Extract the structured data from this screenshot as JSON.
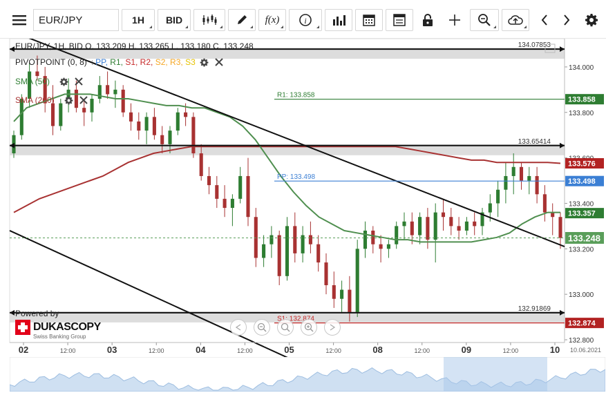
{
  "toolbar": {
    "symbol": "EUR/JPY",
    "timeframe": "1H",
    "side": "BID",
    "indicators_label": "f(x)"
  },
  "legend": {
    "ohlc": "EUR/JPY, 1H, BID    O. 133.209 H. 133.265 L. 133.180 C. 133.248",
    "pivot_title": "PIVOTPOINT (0, 8)",
    "pivot_items": [
      {
        "label": "PP,",
        "color": "#3b7fd4"
      },
      {
        "label": "R1,",
        "color": "#2e7d32"
      },
      {
        "label": "S1,",
        "color": "#c62828"
      },
      {
        "label": "R2,",
        "color": "#c62828"
      },
      {
        "label": "S2,",
        "color": "#f5a623"
      },
      {
        "label": "R3,",
        "color": "#f5a623"
      },
      {
        "label": "S3",
        "color": "#e6c200"
      }
    ],
    "sma50": "SMA (50)",
    "sma200": "SMA (200)"
  },
  "brand": {
    "powered": "Powered by",
    "name": "DUKASCOPY",
    "sub": "Swiss Banking Group"
  },
  "chart_data": {
    "type": "candlestick",
    "symbol": "EUR/JPY",
    "timeframe": "1H",
    "last": {
      "open": 133.209,
      "high": 133.265,
      "low": 133.18,
      "close": 133.248
    },
    "ylim": [
      132.8,
      134.1
    ],
    "y_ticks": [
      132.8,
      133.0,
      133.2,
      133.4,
      133.6,
      133.8,
      134.0
    ],
    "y_tick_labels": [
      "132.800",
      "133.000",
      "133.200",
      "133.400",
      "133.600",
      "133.800",
      "134.000"
    ],
    "x_tick_labels": [
      {
        "label": "02",
        "major": true
      },
      {
        "label": "12:00",
        "major": false
      },
      {
        "label": "03",
        "major": true
      },
      {
        "label": "12:00",
        "major": false
      },
      {
        "label": "04",
        "major": true
      },
      {
        "label": "12:00",
        "major": false
      },
      {
        "label": "05",
        "major": true
      },
      {
        "label": "12:00",
        "major": false
      },
      {
        "label": "08",
        "major": true
      },
      {
        "label": "12:00",
        "major": false
      },
      {
        "label": "09",
        "major": true
      },
      {
        "label": "12:00",
        "major": false
      },
      {
        "label": "10",
        "major": true
      }
    ],
    "date_label": "10.06.2021",
    "horizontal_levels": [
      {
        "label": "134.07853",
        "value": 134.0785
      },
      {
        "label": "133.65414",
        "value": 133.6541
      },
      {
        "label": "132.91869",
        "value": 132.9187
      }
    ],
    "pivot_levels": [
      {
        "label": "R1: 133.858",
        "value": 133.858,
        "color": "#2e7d32"
      },
      {
        "label": "PP: 133.498",
        "value": 133.498,
        "color": "#3b7fd4"
      },
      {
        "label": "S1: 132.874",
        "value": 132.874,
        "color": "#c62828"
      }
    ],
    "price_tags": [
      {
        "label": "133.858",
        "value": 133.858,
        "color": "#2e7d32"
      },
      {
        "label": "133.576",
        "value": 133.576,
        "color": "#b22222"
      },
      {
        "label": "133.498",
        "value": 133.498,
        "color": "#3b7fd4"
      },
      {
        "label": "133.357",
        "value": 133.357,
        "color": "#2e7d32"
      },
      {
        "label": "133.248",
        "value": 133.248,
        "color": "#5a9e5a"
      },
      {
        "label": "132.874",
        "value": 132.874,
        "color": "#b22222"
      }
    ],
    "trend_lines": [
      {
        "x0": 0.0,
        "y0": 134.16,
        "x1": 1.0,
        "y1": 133.21
      },
      {
        "x0": 0.0,
        "y0": 133.28,
        "x1": 0.52,
        "y1": 132.7
      }
    ],
    "sma50": [
      133.76,
      133.82,
      133.84,
      133.86,
      133.88,
      133.88,
      133.88,
      133.87,
      133.86,
      133.86,
      133.85,
      133.84,
      133.83,
      133.83,
      133.82,
      133.82,
      133.8,
      133.78,
      133.74,
      133.68,
      133.6,
      133.52,
      133.45,
      133.39,
      133.34,
      133.31,
      133.28,
      133.27,
      133.26,
      133.25,
      133.24,
      133.24,
      133.23,
      133.23,
      133.23,
      133.23,
      133.23,
      133.24,
      133.25,
      133.27,
      133.31,
      133.34,
      133.36,
      133.36
    ],
    "sma200": [
      133.36,
      133.39,
      133.42,
      133.44,
      133.46,
      133.48,
      133.5,
      133.52,
      133.55,
      133.58,
      133.6,
      133.62,
      133.63,
      133.64,
      133.65,
      133.65,
      133.65,
      133.65,
      133.65,
      133.65,
      133.65,
      133.65,
      133.65,
      133.65,
      133.65,
      133.65,
      133.65,
      133.65,
      133.65,
      133.65,
      133.65,
      133.64,
      133.63,
      133.62,
      133.61,
      133.6,
      133.59,
      133.59,
      133.58,
      133.58,
      133.58,
      133.58,
      133.58,
      133.576
    ],
    "candles": [
      [
        133.62,
        133.72,
        133.6,
        133.7
      ],
      [
        133.7,
        133.88,
        133.68,
        133.86
      ],
      [
        133.86,
        134.02,
        133.82,
        133.98
      ],
      [
        133.98,
        134.05,
        133.94,
        133.96
      ],
      [
        133.96,
        134.0,
        133.8,
        133.84
      ],
      [
        133.84,
        133.92,
        133.7,
        133.74
      ],
      [
        133.74,
        133.86,
        133.72,
        133.84
      ],
      [
        133.84,
        133.95,
        133.8,
        133.9
      ],
      [
        133.9,
        133.94,
        133.8,
        133.82
      ],
      [
        133.82,
        133.86,
        133.74,
        133.8
      ],
      [
        133.8,
        133.88,
        133.76,
        133.86
      ],
      [
        133.86,
        133.96,
        133.84,
        133.92
      ],
      [
        133.92,
        133.98,
        133.86,
        133.88
      ],
      [
        133.88,
        133.94,
        133.82,
        133.9
      ],
      [
        133.9,
        133.92,
        133.78,
        133.8
      ],
      [
        133.8,
        133.84,
        133.72,
        133.76
      ],
      [
        133.76,
        133.8,
        133.68,
        133.72
      ],
      [
        133.72,
        133.8,
        133.66,
        133.78
      ],
      [
        133.78,
        133.82,
        133.68,
        133.7
      ],
      [
        133.7,
        133.74,
        133.62,
        133.66
      ],
      [
        133.66,
        133.74,
        133.62,
        133.72
      ],
      [
        133.72,
        133.82,
        133.7,
        133.8
      ],
      [
        133.8,
        133.84,
        133.74,
        133.78
      ],
      [
        133.78,
        133.8,
        133.6,
        133.62
      ],
      [
        133.62,
        133.66,
        133.5,
        133.52
      ],
      [
        133.52,
        133.56,
        133.44,
        133.48
      ],
      [
        133.48,
        133.52,
        133.38,
        133.42
      ],
      [
        133.42,
        133.48,
        133.34,
        133.38
      ],
      [
        133.38,
        133.44,
        133.3,
        133.42
      ],
      [
        133.42,
        133.56,
        133.4,
        133.52
      ],
      [
        133.52,
        133.6,
        133.3,
        133.34
      ],
      [
        133.34,
        133.38,
        133.12,
        133.16
      ],
      [
        133.16,
        133.26,
        133.12,
        133.22
      ],
      [
        133.22,
        133.3,
        133.16,
        133.26
      ],
      [
        133.26,
        133.28,
        133.04,
        133.08
      ],
      [
        133.08,
        133.34,
        133.06,
        133.3
      ],
      [
        133.3,
        133.36,
        133.14,
        133.18
      ],
      [
        133.18,
        133.3,
        133.14,
        133.26
      ],
      [
        133.26,
        133.32,
        133.18,
        133.22
      ],
      [
        133.22,
        133.26,
        133.1,
        133.14
      ],
      [
        133.14,
        133.18,
        133.0,
        133.04
      ],
      [
        133.04,
        133.1,
        132.94,
        132.98
      ],
      [
        132.98,
        133.06,
        132.92,
        133.02
      ],
      [
        133.02,
        133.08,
        132.88,
        132.92
      ],
      [
        132.92,
        133.24,
        132.9,
        133.2
      ],
      [
        133.2,
        133.32,
        133.16,
        133.28
      ],
      [
        133.28,
        133.3,
        133.18,
        133.22
      ],
      [
        133.22,
        133.26,
        133.14,
        133.2
      ],
      [
        133.2,
        133.24,
        133.16,
        133.22
      ],
      [
        133.22,
        133.32,
        133.2,
        133.3
      ],
      [
        133.3,
        133.36,
        133.24,
        133.32
      ],
      [
        133.32,
        133.36,
        133.22,
        133.26
      ],
      [
        133.26,
        133.36,
        133.22,
        133.34
      ],
      [
        133.34,
        133.38,
        133.2,
        133.24
      ],
      [
        133.24,
        133.4,
        133.14,
        133.36
      ],
      [
        133.36,
        133.42,
        133.28,
        133.34
      ],
      [
        133.34,
        133.38,
        133.26,
        133.3
      ],
      [
        133.3,
        133.34,
        133.24,
        133.28
      ],
      [
        133.28,
        133.34,
        133.26,
        133.32
      ],
      [
        133.32,
        133.36,
        133.26,
        133.3
      ],
      [
        133.3,
        133.38,
        133.26,
        133.36
      ],
      [
        133.36,
        133.44,
        133.32,
        133.4
      ],
      [
        133.4,
        133.5,
        133.34,
        133.46
      ],
      [
        133.46,
        133.58,
        133.4,
        133.52
      ],
      [
        133.52,
        133.62,
        133.44,
        133.56
      ],
      [
        133.56,
        133.58,
        133.46,
        133.5
      ],
      [
        133.5,
        133.56,
        133.44,
        133.52
      ],
      [
        133.52,
        133.56,
        133.4,
        133.44
      ],
      [
        133.44,
        133.48,
        133.32,
        133.36
      ],
      [
        133.36,
        133.4,
        133.26,
        133.34
      ],
      [
        133.34,
        133.36,
        133.2,
        133.248
      ]
    ]
  },
  "nav": {
    "labels": [
      "prev",
      "zoom-out",
      "reset",
      "zoom-in",
      "next"
    ]
  }
}
